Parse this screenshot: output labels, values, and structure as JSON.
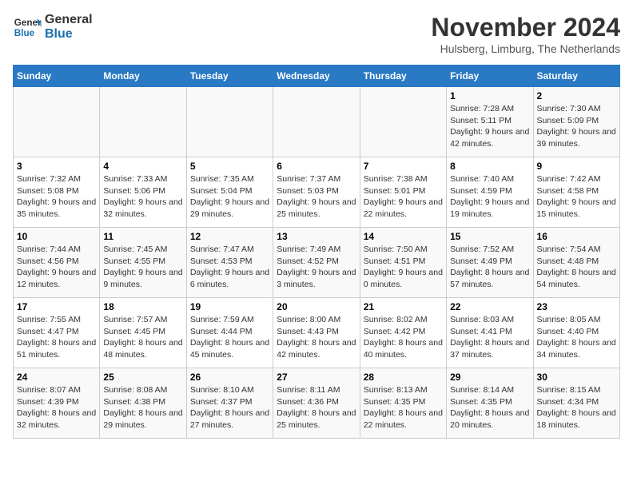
{
  "header": {
    "logo_line1": "General",
    "logo_line2": "Blue",
    "month": "November 2024",
    "location": "Hulsberg, Limburg, The Netherlands"
  },
  "weekdays": [
    "Sunday",
    "Monday",
    "Tuesday",
    "Wednesday",
    "Thursday",
    "Friday",
    "Saturday"
  ],
  "weeks": [
    [
      {
        "day": "",
        "info": ""
      },
      {
        "day": "",
        "info": ""
      },
      {
        "day": "",
        "info": ""
      },
      {
        "day": "",
        "info": ""
      },
      {
        "day": "",
        "info": ""
      },
      {
        "day": "1",
        "info": "Sunrise: 7:28 AM\nSunset: 5:11 PM\nDaylight: 9 hours and 42 minutes."
      },
      {
        "day": "2",
        "info": "Sunrise: 7:30 AM\nSunset: 5:09 PM\nDaylight: 9 hours and 39 minutes."
      }
    ],
    [
      {
        "day": "3",
        "info": "Sunrise: 7:32 AM\nSunset: 5:08 PM\nDaylight: 9 hours and 35 minutes."
      },
      {
        "day": "4",
        "info": "Sunrise: 7:33 AM\nSunset: 5:06 PM\nDaylight: 9 hours and 32 minutes."
      },
      {
        "day": "5",
        "info": "Sunrise: 7:35 AM\nSunset: 5:04 PM\nDaylight: 9 hours and 29 minutes."
      },
      {
        "day": "6",
        "info": "Sunrise: 7:37 AM\nSunset: 5:03 PM\nDaylight: 9 hours and 25 minutes."
      },
      {
        "day": "7",
        "info": "Sunrise: 7:38 AM\nSunset: 5:01 PM\nDaylight: 9 hours and 22 minutes."
      },
      {
        "day": "8",
        "info": "Sunrise: 7:40 AM\nSunset: 4:59 PM\nDaylight: 9 hours and 19 minutes."
      },
      {
        "day": "9",
        "info": "Sunrise: 7:42 AM\nSunset: 4:58 PM\nDaylight: 9 hours and 15 minutes."
      }
    ],
    [
      {
        "day": "10",
        "info": "Sunrise: 7:44 AM\nSunset: 4:56 PM\nDaylight: 9 hours and 12 minutes."
      },
      {
        "day": "11",
        "info": "Sunrise: 7:45 AM\nSunset: 4:55 PM\nDaylight: 9 hours and 9 minutes."
      },
      {
        "day": "12",
        "info": "Sunrise: 7:47 AM\nSunset: 4:53 PM\nDaylight: 9 hours and 6 minutes."
      },
      {
        "day": "13",
        "info": "Sunrise: 7:49 AM\nSunset: 4:52 PM\nDaylight: 9 hours and 3 minutes."
      },
      {
        "day": "14",
        "info": "Sunrise: 7:50 AM\nSunset: 4:51 PM\nDaylight: 9 hours and 0 minutes."
      },
      {
        "day": "15",
        "info": "Sunrise: 7:52 AM\nSunset: 4:49 PM\nDaylight: 8 hours and 57 minutes."
      },
      {
        "day": "16",
        "info": "Sunrise: 7:54 AM\nSunset: 4:48 PM\nDaylight: 8 hours and 54 minutes."
      }
    ],
    [
      {
        "day": "17",
        "info": "Sunrise: 7:55 AM\nSunset: 4:47 PM\nDaylight: 8 hours and 51 minutes."
      },
      {
        "day": "18",
        "info": "Sunrise: 7:57 AM\nSunset: 4:45 PM\nDaylight: 8 hours and 48 minutes."
      },
      {
        "day": "19",
        "info": "Sunrise: 7:59 AM\nSunset: 4:44 PM\nDaylight: 8 hours and 45 minutes."
      },
      {
        "day": "20",
        "info": "Sunrise: 8:00 AM\nSunset: 4:43 PM\nDaylight: 8 hours and 42 minutes."
      },
      {
        "day": "21",
        "info": "Sunrise: 8:02 AM\nSunset: 4:42 PM\nDaylight: 8 hours and 40 minutes."
      },
      {
        "day": "22",
        "info": "Sunrise: 8:03 AM\nSunset: 4:41 PM\nDaylight: 8 hours and 37 minutes."
      },
      {
        "day": "23",
        "info": "Sunrise: 8:05 AM\nSunset: 4:40 PM\nDaylight: 8 hours and 34 minutes."
      }
    ],
    [
      {
        "day": "24",
        "info": "Sunrise: 8:07 AM\nSunset: 4:39 PM\nDaylight: 8 hours and 32 minutes."
      },
      {
        "day": "25",
        "info": "Sunrise: 8:08 AM\nSunset: 4:38 PM\nDaylight: 8 hours and 29 minutes."
      },
      {
        "day": "26",
        "info": "Sunrise: 8:10 AM\nSunset: 4:37 PM\nDaylight: 8 hours and 27 minutes."
      },
      {
        "day": "27",
        "info": "Sunrise: 8:11 AM\nSunset: 4:36 PM\nDaylight: 8 hours and 25 minutes."
      },
      {
        "day": "28",
        "info": "Sunrise: 8:13 AM\nSunset: 4:35 PM\nDaylight: 8 hours and 22 minutes."
      },
      {
        "day": "29",
        "info": "Sunrise: 8:14 AM\nSunset: 4:35 PM\nDaylight: 8 hours and 20 minutes."
      },
      {
        "day": "30",
        "info": "Sunrise: 8:15 AM\nSunset: 4:34 PM\nDaylight: 8 hours and 18 minutes."
      }
    ]
  ]
}
